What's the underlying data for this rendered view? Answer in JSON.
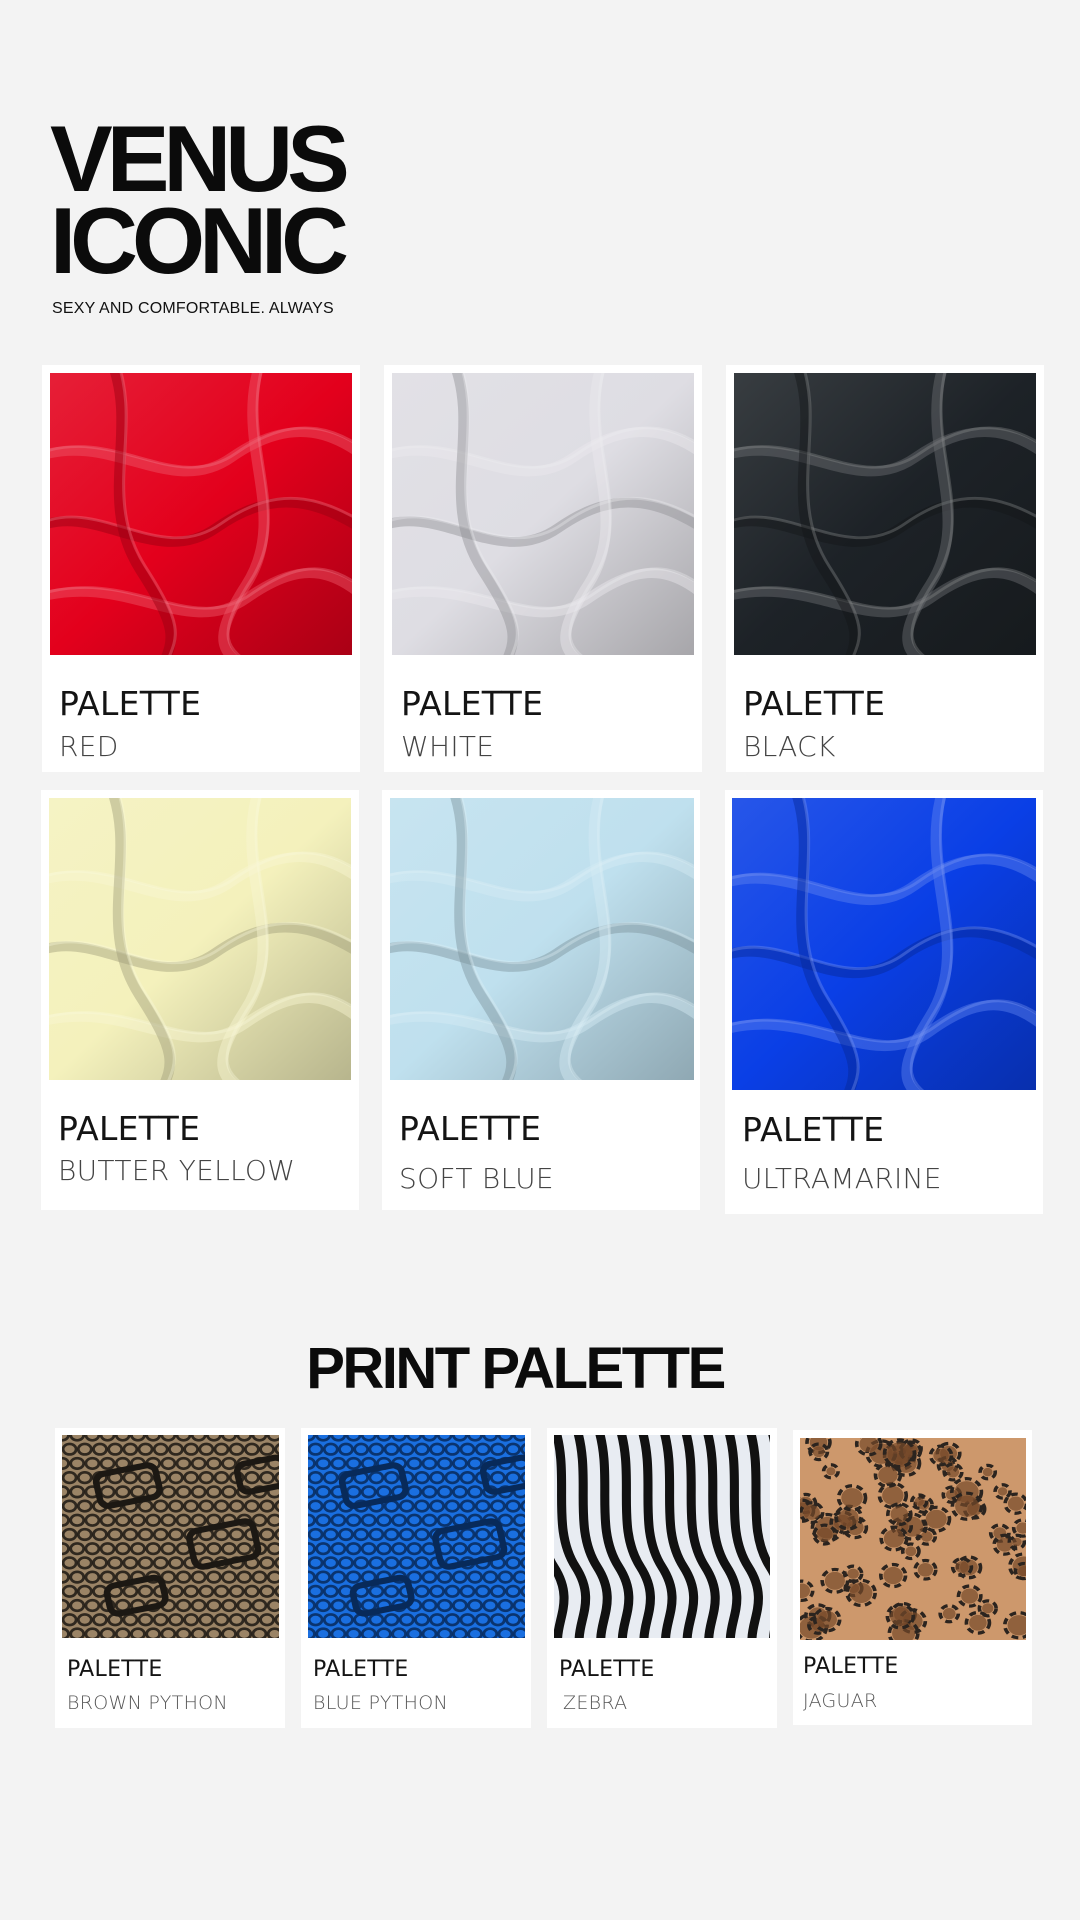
{
  "brand": {
    "title_line1": "VENUS",
    "title_line2": "ICONIC",
    "tagline": "SEXY AND COMFORTABLE. ALWAYS"
  },
  "solid_palettes": [
    {
      "title": "PALETTE",
      "name": "RED",
      "fabric_color": "#e3001c",
      "pattern": "solid"
    },
    {
      "title": "PALETTE",
      "name": "WHITE",
      "fabric_color": "#dedde3",
      "pattern": "solid"
    },
    {
      "title": "PALETTE",
      "name": "BLACK",
      "fabric_color": "#1d2227",
      "pattern": "solid"
    },
    {
      "title": "PALETTE",
      "name": "BUTTER YELLOW",
      "fabric_color": "#f4f1bc",
      "pattern": "solid"
    },
    {
      "title": "PALETTE",
      "name": "SOFT BLUE",
      "fabric_color": "#bfe0ee",
      "pattern": "solid"
    },
    {
      "title": "PALETTE",
      "name": "ULTRAMARINE",
      "fabric_color": "#0a3fe6",
      "pattern": "solid"
    }
  ],
  "print_section": {
    "title": "PRINT PALETTE"
  },
  "print_palettes": [
    {
      "title": "PALETTE",
      "name": "BROWN PYTHON",
      "fabric_color": "#9b8466",
      "pattern": "python-brown"
    },
    {
      "title": "PALETTE",
      "name": "BLUE PYTHON",
      "fabric_color": "#1a6fe0",
      "pattern": "python-blue"
    },
    {
      "title": "PALETTE",
      "name": "ZEBRA",
      "fabric_color": "#e8ecf2",
      "pattern": "zebra"
    },
    {
      "title": "PALETTE",
      "name": "JAGUAR",
      "fabric_color": "#c99060",
      "pattern": "jaguar"
    }
  ]
}
